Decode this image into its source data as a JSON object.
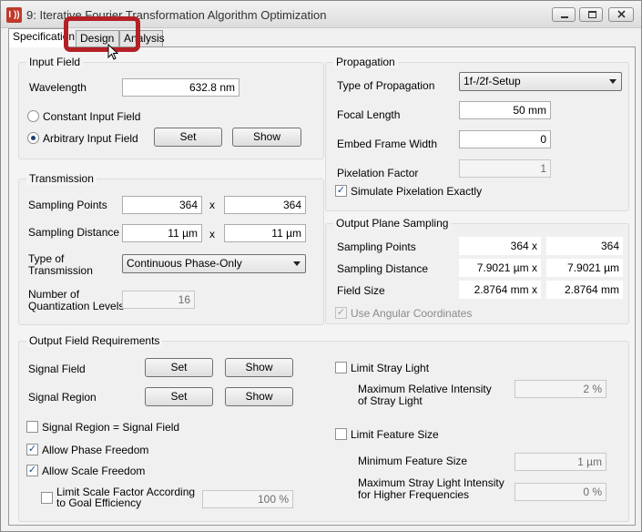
{
  "window": {
    "title": "9: Iterative Fourier Transformation Algorithm Optimization",
    "app_icon_text": "I ))"
  },
  "tabs": [
    {
      "label": "Specification",
      "active": true
    },
    {
      "label": "Design",
      "active": false
    },
    {
      "label": "Analysis",
      "active": false
    }
  ],
  "input_field": {
    "title": "Input Field",
    "wavelength_label": "Wavelength",
    "wavelength_value": "632.8 nm",
    "constant_label": "Constant Input Field",
    "arbitrary_label": "Arbitrary Input Field",
    "set_label": "Set",
    "show_label": "Show"
  },
  "transmission": {
    "title": "Transmission",
    "sampling_points_label": "Sampling Points",
    "sampling_points_x": "364",
    "sampling_points_y": "364",
    "sampling_distance_label": "Sampling Distance",
    "sampling_distance_x": "11 µm",
    "sampling_distance_y": "11 µm",
    "times": "x",
    "type_label_1": "Type of",
    "type_label_2": "Transmission",
    "type_value": "Continuous Phase-Only",
    "quant_label_1": "Number of",
    "quant_label_2": "Quantization Levels",
    "quant_value": "16"
  },
  "propagation": {
    "title": "Propagation",
    "type_label": "Type of Propagation",
    "type_value": "1f-/2f-Setup",
    "focal_label": "Focal Length",
    "focal_value": "50 mm",
    "embed_label": "Embed Frame Width",
    "embed_value": "0",
    "pixelation_label": "Pixelation Factor",
    "pixelation_value": "1",
    "simulate_label": "Simulate Pixelation Exactly"
  },
  "output_plane": {
    "title": "Output Plane Sampling",
    "sampling_points_label": "Sampling Points",
    "sampling_points_x": "364 x",
    "sampling_points_y": "364",
    "sampling_distance_label": "Sampling Distance",
    "sampling_distance_x": "7.9021 µm x",
    "sampling_distance_y": "7.9021 µm",
    "field_size_label": "Field Size",
    "field_size_x": "2.8764 mm x",
    "field_size_y": "2.8764 mm",
    "angular_label": "Use Angular Coordinates"
  },
  "output_requirements": {
    "title": "Output Field Requirements",
    "signal_field_label": "Signal Field",
    "signal_region_label": "Signal Region",
    "set_label": "Set",
    "show_label": "Show",
    "region_eq_field_label": "Signal Region = Signal Field",
    "phase_freedom_label": "Allow Phase Freedom",
    "scale_freedom_label": "Allow Scale Freedom",
    "limit_scale_label_1": "Limit Scale Factor According",
    "limit_scale_label_2": "to Goal Efficiency",
    "limit_scale_value": "100 %",
    "stray_light_label": "Limit Stray Light",
    "max_rel_label_1": "Maximum Relative Intensity",
    "max_rel_label_2": "of Stray Light",
    "max_rel_value": "2 %",
    "feature_size_label": "Limit Feature Size",
    "min_feature_label": "Minimum Feature Size",
    "min_feature_value": "1 µm",
    "max_stray_hf_label_1": "Maximum Stray Light Intensity",
    "max_stray_hf_label_2": "for Higher Frequencies",
    "max_stray_hf_value": "0 %"
  },
  "glyphs": {
    "check": "✓"
  }
}
